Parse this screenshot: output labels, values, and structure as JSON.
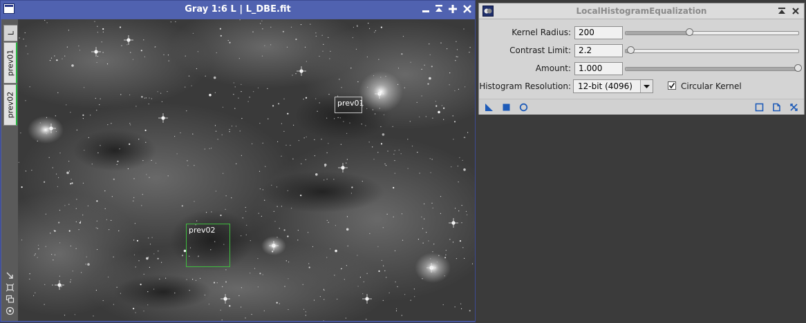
{
  "image_window": {
    "title": "Gray 1:6 L | L_DBE.fit",
    "main_view_tab": "L",
    "preview_tabs": [
      "prev01",
      "prev02"
    ],
    "previews": [
      {
        "label": "prev01",
        "border_color": "#c8c8c8"
      },
      {
        "label": "prev02",
        "border_color": "#3fbf3f"
      }
    ]
  },
  "process": {
    "title": "LocalHistogramEqualization",
    "kernel_radius": {
      "label": "Kernel Radius:",
      "value": "200",
      "slider_fraction": 0.37
    },
    "contrast_limit": {
      "label": "Contrast Limit:",
      "value": "2.2",
      "slider_fraction": 0.03
    },
    "amount": {
      "label": "Amount:",
      "value": "1.000",
      "slider_fraction": 1.0
    },
    "histogram_resolution": {
      "label": "Histogram Resolution:",
      "value": "12-bit (4096)"
    },
    "circular_kernel": {
      "label": "Circular Kernel",
      "checked": true
    }
  },
  "icons": {
    "window_buttons": [
      "minimize-icon",
      "shade-icon",
      "maximize-icon",
      "close-icon"
    ],
    "side_tools": [
      "zoom-arrow-icon",
      "crop-icon",
      "clone-icon",
      "target-icon"
    ],
    "process_left": [
      "new-instance-icon",
      "apply-square-icon",
      "apply-global-icon"
    ],
    "process_right": [
      "preferences-icon",
      "documentation-icon",
      "reset-icon"
    ]
  },
  "colors": {
    "window_frame": "#5062b0",
    "preview_active": "#23b33d",
    "accent_blue": "#1e5bb8"
  }
}
